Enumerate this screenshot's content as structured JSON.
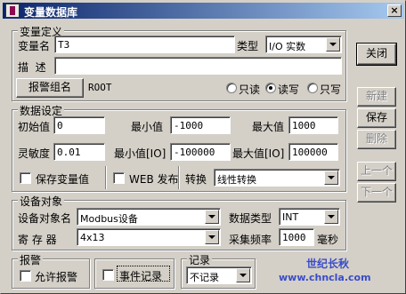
{
  "window": {
    "title": "变量数据库",
    "close_glyph": "×"
  },
  "define_group": {
    "title": "变量定义",
    "var_name_label": "变量名",
    "var_name_value": "T3",
    "type_label": "类型",
    "type_value": "I/O 实数",
    "desc_label": "描  述",
    "desc_value": "",
    "alarm_group_button": "报警组名",
    "alarm_group_value": "ROOT",
    "access_options": [
      {
        "label": "只读",
        "checked": false
      },
      {
        "label": "读写",
        "checked": true
      },
      {
        "label": "只写",
        "checked": false
      }
    ]
  },
  "data_group": {
    "title": "数据设定",
    "init_label": "初始值",
    "init_value": "0",
    "min_label": "最小值",
    "min_value": "-1000",
    "max_label": "最大值",
    "max_value": "1000",
    "sens_label": "灵敏度",
    "sens_value": "0.01",
    "min_io_label": "最小值[IO]",
    "min_io_value": "-100000",
    "max_io_label": "最大值[IO]",
    "max_io_value": "100000",
    "save_var_label": "保存变量值",
    "save_var_checked": false,
    "web_label": "WEB 发布",
    "web_checked": false,
    "convert_label": "转换",
    "convert_value": "线性转换"
  },
  "device_group": {
    "title": "设备对象",
    "device_label": "设备对象名",
    "device_value": "Modbus设备",
    "datatype_label": "数据类型",
    "datatype_value": "INT",
    "register_label": "寄 存 器",
    "register_value": "4x13",
    "freq_label": "采集频率",
    "freq_value": "1000",
    "freq_unit": "毫秒"
  },
  "alarm_group": {
    "title": "报警",
    "allow_label": "允许报警",
    "allow_checked": false
  },
  "event_group": {
    "label": "事件记录",
    "checked": false
  },
  "record_group": {
    "title": "记录",
    "value": "不记录"
  },
  "side_buttons": {
    "close": "关闭",
    "new": "新建",
    "save": "保存",
    "delete": "删除",
    "prev": "上一个",
    "next": "下一个"
  },
  "watermark": {
    "brand": "世纪长秋",
    "url": "www.chncla.com"
  }
}
